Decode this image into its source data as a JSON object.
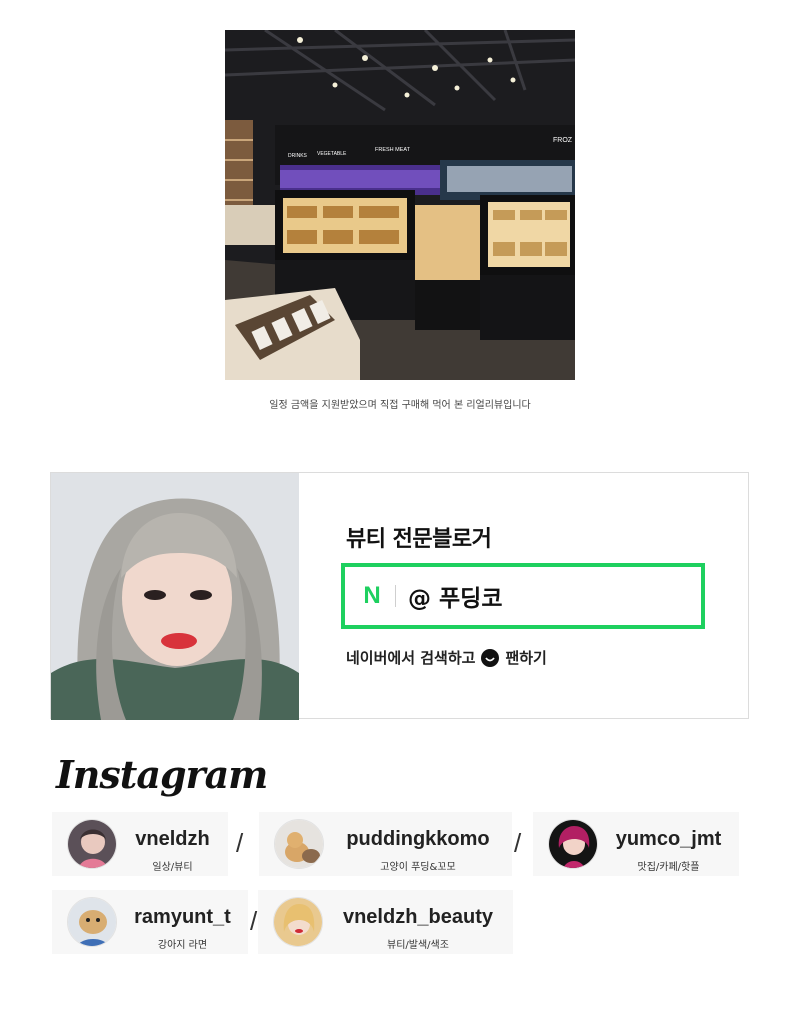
{
  "photo_caption": "일정 금액을 지원받았으며 직접 구매해 먹어 본 리얼리뷰입니다",
  "store_signs": {
    "drinks": "DRINKS",
    "vegetable": "VEGETABLE",
    "fresh_meat": "FRESH MEAT",
    "frozen": "FROZ"
  },
  "blogger": {
    "title": "뷰티 전문블로거",
    "naver_logo": "N",
    "handle": "@ 푸딩코",
    "fan_text_before": "네이버에서 검색하고",
    "fan_text_after": "팬하기"
  },
  "instagram": {
    "title": "Instagram",
    "separator": "/",
    "accounts": [
      {
        "handle": "vneldzh",
        "desc": "일상/뷰티"
      },
      {
        "handle": "puddingkkomo",
        "desc": "고양이 푸딩&꼬모"
      },
      {
        "handle": "yumco_jmt",
        "desc": "맛집/카페/핫플"
      },
      {
        "handle": "ramyunt_t",
        "desc": "강아지 라면"
      },
      {
        "handle": "vneldzh_beauty",
        "desc": "뷰티/발색/색조"
      }
    ]
  }
}
